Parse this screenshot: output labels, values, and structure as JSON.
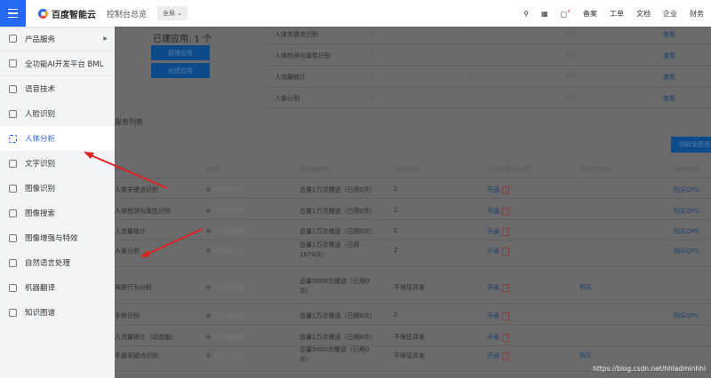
{
  "header": {
    "logo": "百度智能云",
    "console": "控制台总览",
    "scope": "全局",
    "links": [
      "备案",
      "工单",
      "文档",
      "企业",
      "财务"
    ]
  },
  "sidebar": {
    "items": [
      {
        "label": "产品服务",
        "icon": "grid-icon"
      },
      {
        "label": "全功能AI开发平台 BML",
        "icon": "nodes-icon"
      },
      {
        "label": "语音技术",
        "icon": "microphone-icon"
      },
      {
        "label": "人脸识别",
        "icon": "face-icon"
      },
      {
        "label": "人体分析",
        "icon": "body-scan-icon",
        "active": true
      },
      {
        "label": "文字识别",
        "icon": "text-icon"
      },
      {
        "label": "图像识别",
        "icon": "image-icon"
      },
      {
        "label": "图像搜索",
        "icon": "image-search-icon"
      },
      {
        "label": "图像增强与特效",
        "icon": "image-enhance-icon"
      },
      {
        "label": "自然语言处理",
        "icon": "nlp-icon"
      },
      {
        "label": "机器翻译",
        "icon": "translate-icon"
      },
      {
        "label": "知识图谱",
        "icon": "knowledge-graph-icon"
      }
    ]
  },
  "apps": {
    "count_label": "已建应用: 1 个",
    "manage": "管理应用",
    "create": "创建应用"
  },
  "summary_rows": [
    {
      "name": "人体关键点识别",
      "a": "0",
      "b": "0",
      "pct": "0%",
      "action": "查看"
    },
    {
      "name": "人体检测与属性识别",
      "a": "0",
      "b": "0",
      "pct": "0%",
      "action": "查看"
    },
    {
      "name": "人流量统计",
      "a": "0",
      "b": "0",
      "pct": "0%",
      "action": "查看"
    },
    {
      "name": "人像分割",
      "a": "0",
      "b": "0",
      "pct": "0%",
      "action": "查看"
    }
  ],
  "section_title": "服务列表",
  "free_button": "领取免费资源",
  "table": {
    "headers": [
      "API",
      "状态",
      "调用量限制",
      "QPS限制",
      "开通按量后付费",
      "购买次数包",
      "QPS购买"
    ],
    "rows": [
      {
        "api": "人体关键点识别",
        "status": "待开通付费",
        "limit": "总量1万次赠送（已用0次）",
        "qps": "2",
        "open": "开通",
        "pack": "--",
        "qps_buy": "购买QPS"
      },
      {
        "api": "人体检测与属性识别",
        "status": "待开通付费",
        "limit": "总量1万次赠送（已用0次）",
        "qps": "2",
        "open": "开通",
        "pack": "--",
        "qps_buy": "购买QPS"
      },
      {
        "api": "人流量统计",
        "status": "待开通付费",
        "limit": "总量1万次赠送（已用0次）",
        "qps": "2",
        "open": "开通",
        "pack": "--",
        "qps_buy": "购买QPS"
      },
      {
        "api": "人像分割",
        "status": "待开通付费",
        "limit": "总量1万次赠送（已用1674次）",
        "qps": "2",
        "open": "开通",
        "pack": "--",
        "qps_buy": "购买QPS"
      },
      {
        "api": "驾驶行为分析",
        "status": "待开通付费",
        "limit": "总量5000次赠送（已用0次）",
        "qps": "不保证并发",
        "open": "开通",
        "pack": "购买",
        "qps_buy": "--"
      },
      {
        "api": "手势识别",
        "status": "待开通付费",
        "limit": "总量1万次赠送（已用0次）",
        "qps": "2",
        "open": "开通",
        "pack": "--",
        "qps_buy": "购买QPS"
      },
      {
        "api": "人流量统计（动态版）",
        "status": "待开通付费",
        "limit": "总量1万次赠送（已用0次）",
        "qps": "不保证并发",
        "open": "开通",
        "pack": "--",
        "qps_buy": "--"
      },
      {
        "api": "手部关键点识别",
        "status": "待开通付费",
        "limit": "总量5000次赠送（已用0次）",
        "qps": "不保证并发",
        "open": "开通",
        "pack": "购买",
        "qps_buy": "--"
      }
    ]
  },
  "watermark": "https://blog.csdn.net/hhladminhhl",
  "colors": {
    "accent": "#2468f2",
    "annotation_arrow": "#e02020"
  }
}
